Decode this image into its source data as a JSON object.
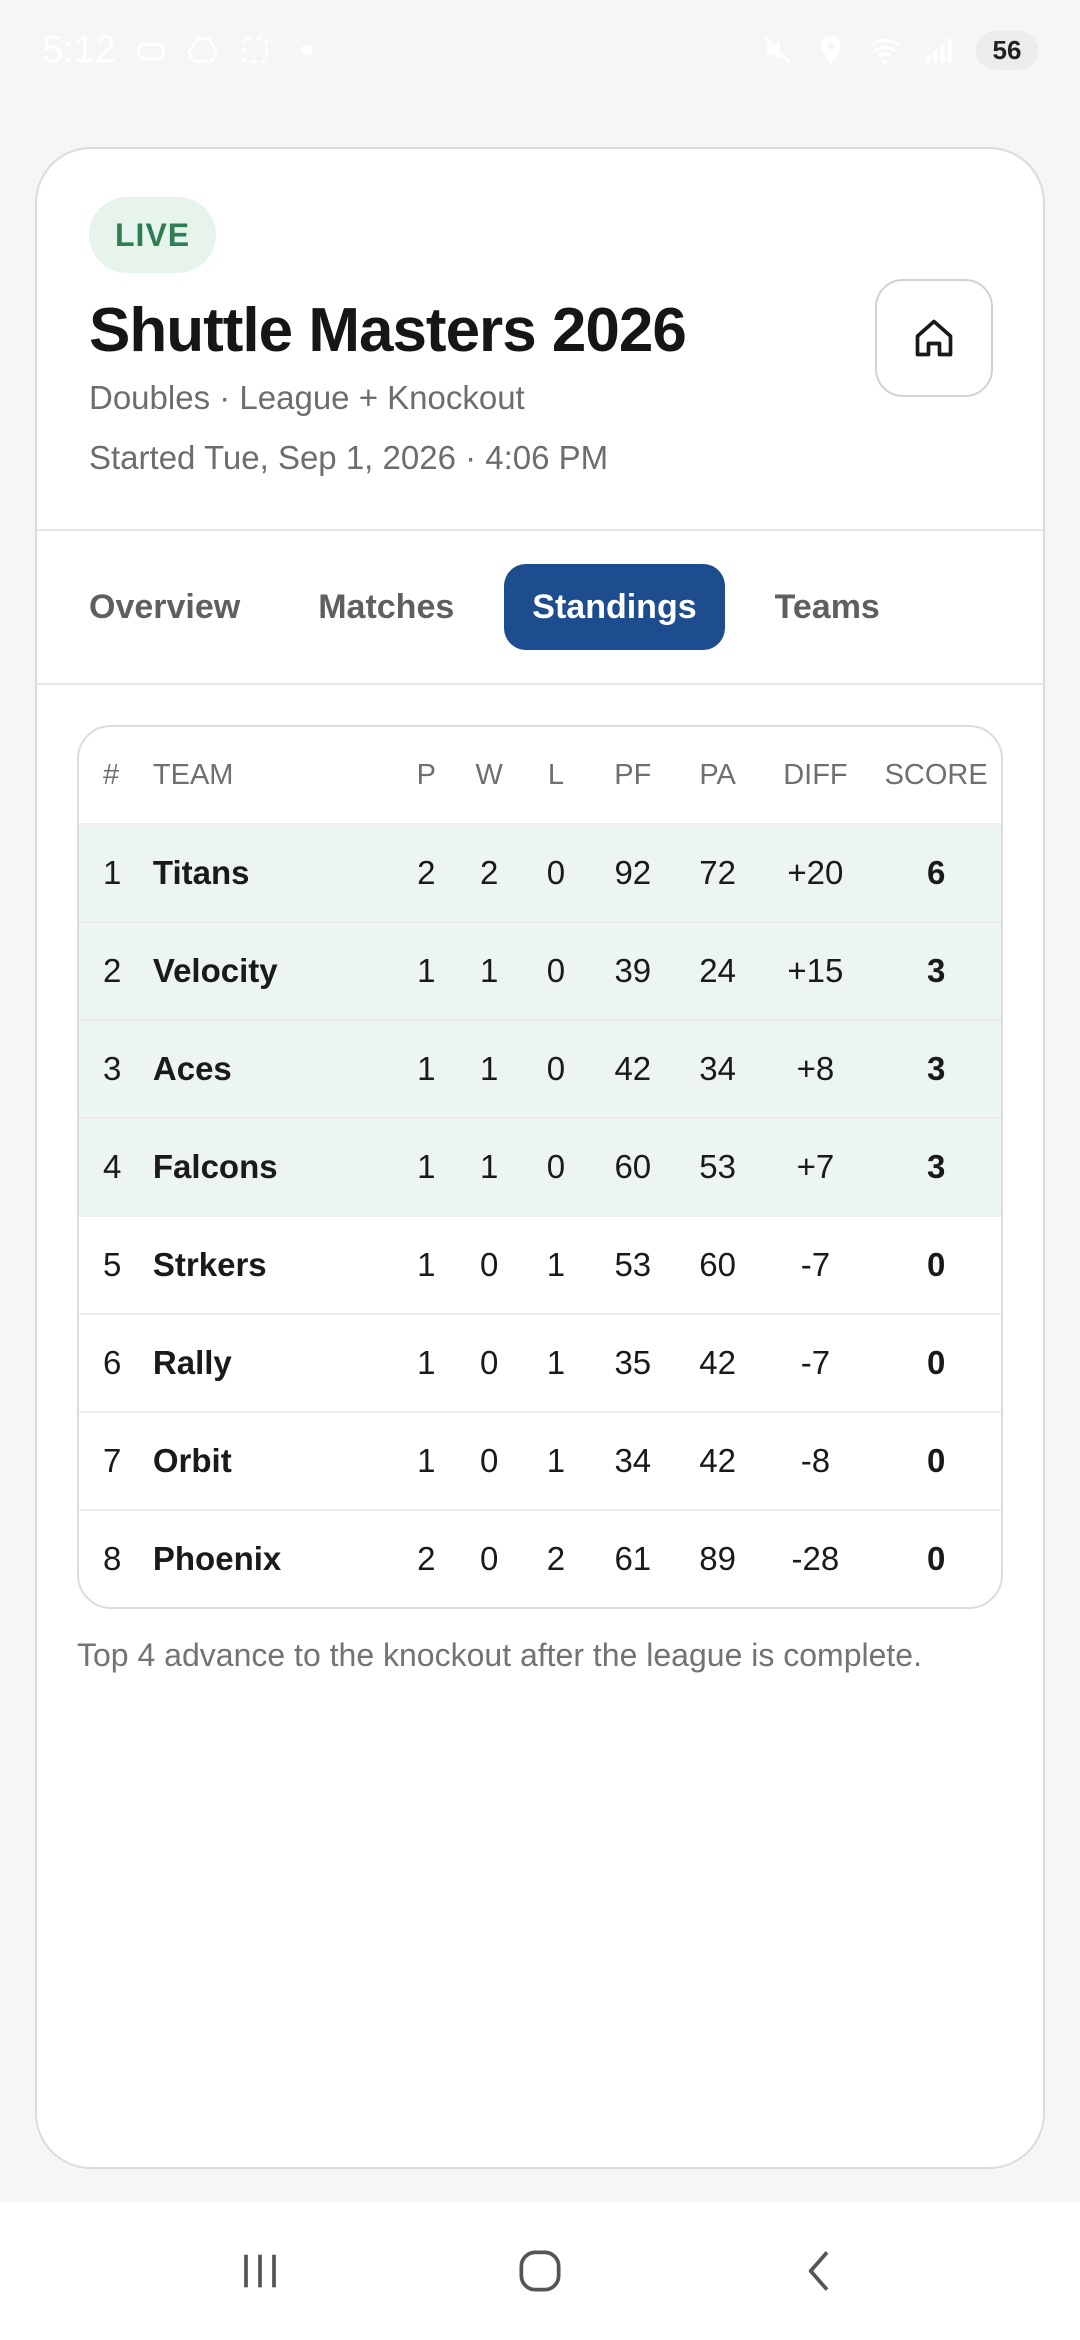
{
  "status_bar": {
    "time": "5:12",
    "battery": "56"
  },
  "header": {
    "badge": "LIVE",
    "title": "Shuttle Masters 2026",
    "subtitle": "Doubles · League + Knockout",
    "started": "Started Tue, Sep 1, 2026 · 4:06 PM"
  },
  "tabs": [
    {
      "label": "Overview",
      "active": false
    },
    {
      "label": "Matches",
      "active": false
    },
    {
      "label": "Standings",
      "active": true
    },
    {
      "label": "Teams",
      "active": false
    }
  ],
  "table": {
    "headers": {
      "rank": "#",
      "team": "TEAM",
      "p": "P",
      "w": "W",
      "l": "L",
      "pf": "PF",
      "pa": "PA",
      "diff": "DIFF",
      "score": "SCORE"
    },
    "rows": [
      {
        "rank": "1",
        "team": "Titans",
        "p": "2",
        "w": "2",
        "l": "0",
        "pf": "92",
        "pa": "72",
        "diff": "+20",
        "score": "6",
        "advancing": true
      },
      {
        "rank": "2",
        "team": "Velocity",
        "p": "1",
        "w": "1",
        "l": "0",
        "pf": "39",
        "pa": "24",
        "diff": "+15",
        "score": "3",
        "advancing": true
      },
      {
        "rank": "3",
        "team": "Aces",
        "p": "1",
        "w": "1",
        "l": "0",
        "pf": "42",
        "pa": "34",
        "diff": "+8",
        "score": "3",
        "advancing": true
      },
      {
        "rank": "4",
        "team": "Falcons",
        "p": "1",
        "w": "1",
        "l": "0",
        "pf": "60",
        "pa": "53",
        "diff": "+7",
        "score": "3",
        "advancing": true
      },
      {
        "rank": "5",
        "team": "Strkers",
        "p": "1",
        "w": "0",
        "l": "1",
        "pf": "53",
        "pa": "60",
        "diff": "-7",
        "score": "0",
        "advancing": false
      },
      {
        "rank": "6",
        "team": "Rally",
        "p": "1",
        "w": "0",
        "l": "1",
        "pf": "35",
        "pa": "42",
        "diff": "-7",
        "score": "0",
        "advancing": false
      },
      {
        "rank": "7",
        "team": "Orbit",
        "p": "1",
        "w": "0",
        "l": "1",
        "pf": "34",
        "pa": "42",
        "diff": "-8",
        "score": "0",
        "advancing": false
      },
      {
        "rank": "8",
        "team": "Phoenix",
        "p": "2",
        "w": "0",
        "l": "2",
        "pf": "61",
        "pa": "89",
        "diff": "-28",
        "score": "0",
        "advancing": false
      }
    ]
  },
  "note": "Top 4 advance to the knockout after the league is complete.",
  "colors": {
    "accent": "#1d4d8f",
    "live_bg": "#e6f4ec",
    "live_text": "#2e7d53",
    "advancing_row": "#ecf5ef"
  },
  "icons": {
    "home": "home-icon",
    "nav_recents": "recents-icon",
    "nav_home": "home-circle-icon",
    "nav_back": "back-icon"
  }
}
